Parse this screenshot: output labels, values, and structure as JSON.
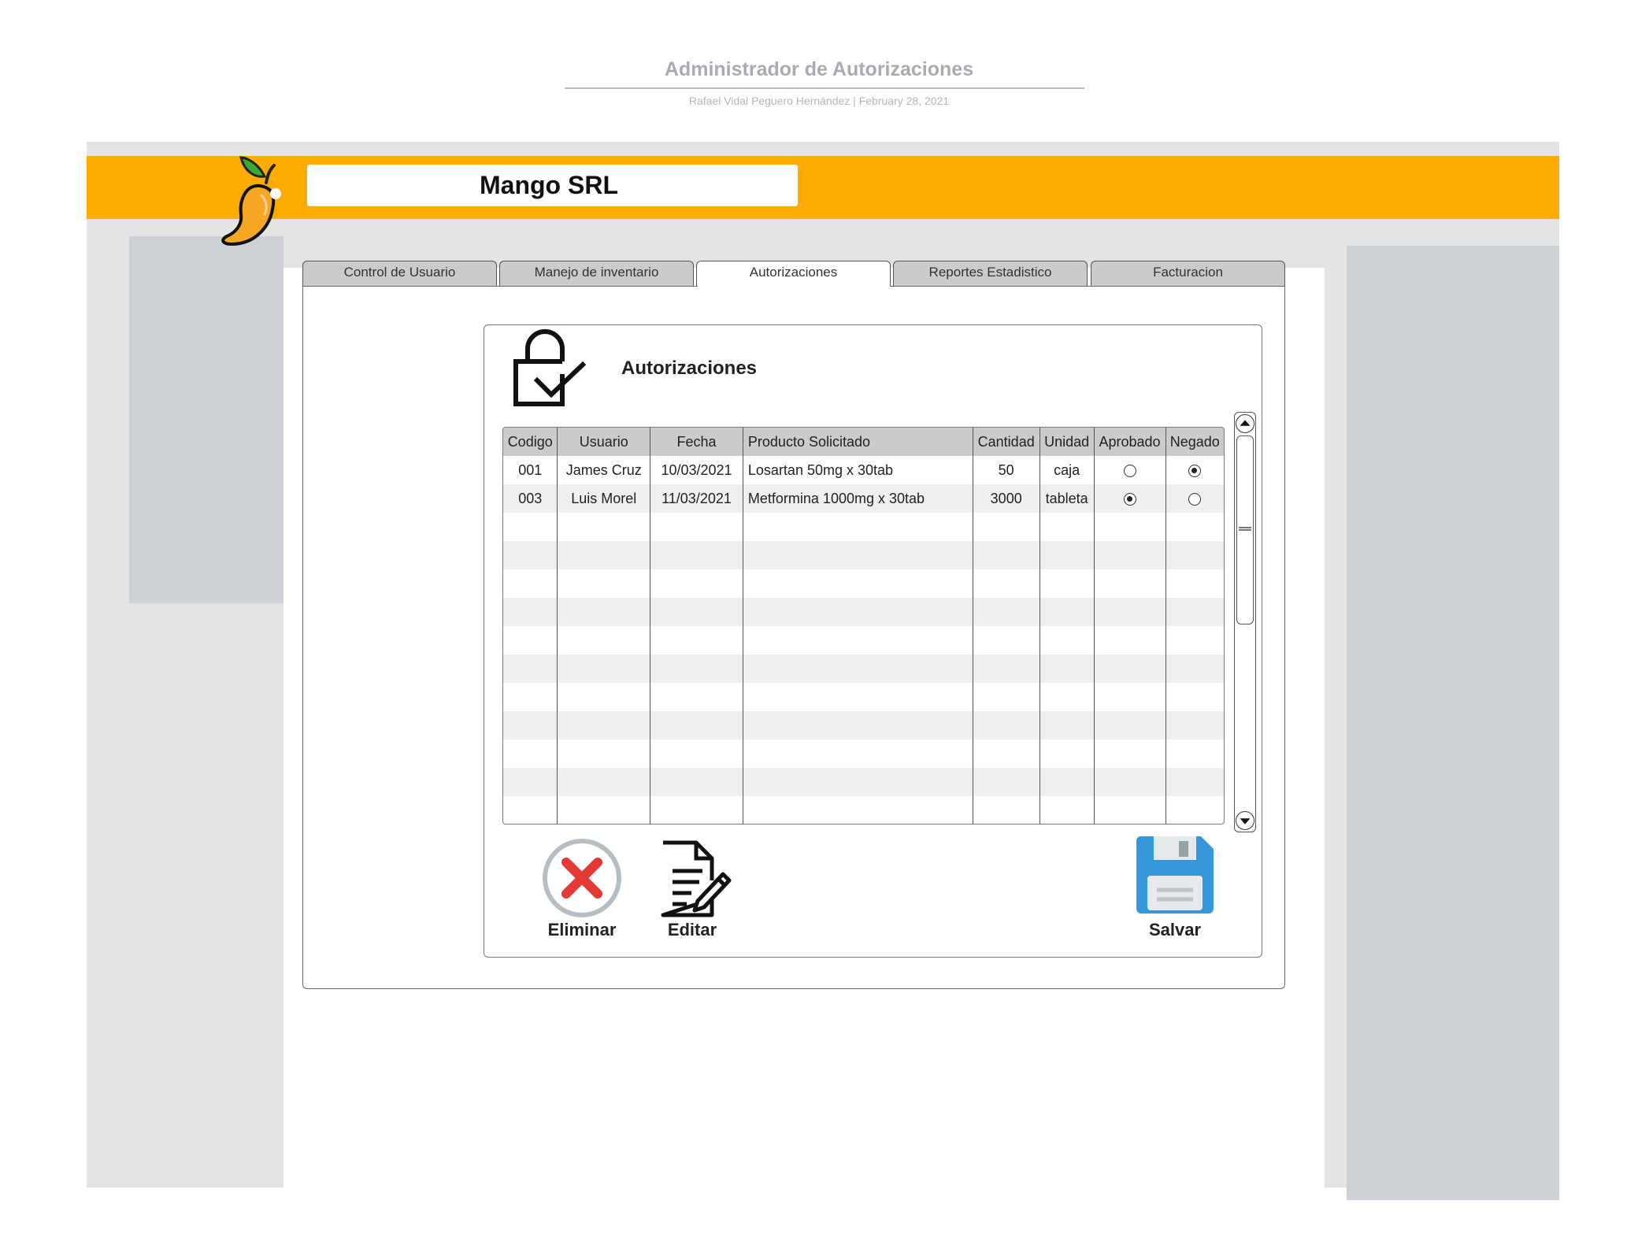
{
  "document": {
    "title": "Administrador de Autorizaciones",
    "subtitle": "Rafael Vidal Peguero Hernández  |  February 28, 2021"
  },
  "header": {
    "company_name": "Mango SRL",
    "logo_icon": "mango-icon"
  },
  "tabs": [
    {
      "label": "Control de Usuario",
      "active": false
    },
    {
      "label": "Manejo de inventario",
      "active": false
    },
    {
      "label": "Autorizaciones",
      "active": true
    },
    {
      "label": "Reportes Estadistico",
      "active": false
    },
    {
      "label": "Facturacion",
      "active": false
    }
  ],
  "panel": {
    "title": "Autorizaciones",
    "icon": "lock-check-icon"
  },
  "table": {
    "columns": [
      "Codigo",
      "Usuario",
      "Fecha",
      "Producto Solicitado",
      "Cantidad",
      "Unidad",
      "Aprobado",
      "Negado"
    ],
    "rows": [
      {
        "codigo": "001",
        "usuario": "James Cruz",
        "fecha": "10/03/2021",
        "producto": "Losartan 50mg x 30tab",
        "cantidad": "50",
        "unidad": "caja",
        "aprobado": false,
        "negado": true
      },
      {
        "codigo": "003",
        "usuario": "Luis Morel",
        "fecha": "11/03/2021",
        "producto": "Metformina 1000mg x 30tab",
        "cantidad": "3000",
        "unidad": "tableta",
        "aprobado": true,
        "negado": false
      }
    ],
    "empty_rows": 11
  },
  "actions": {
    "delete_label": "Eliminar",
    "edit_label": "Editar",
    "save_label": "Salvar"
  },
  "colors": {
    "header_bar": "#fdab00",
    "tab_inactive": "#cbcbcb",
    "side_panels": "#cdd0d5",
    "delete_red": "#e53935",
    "save_blue": "#3498db"
  }
}
